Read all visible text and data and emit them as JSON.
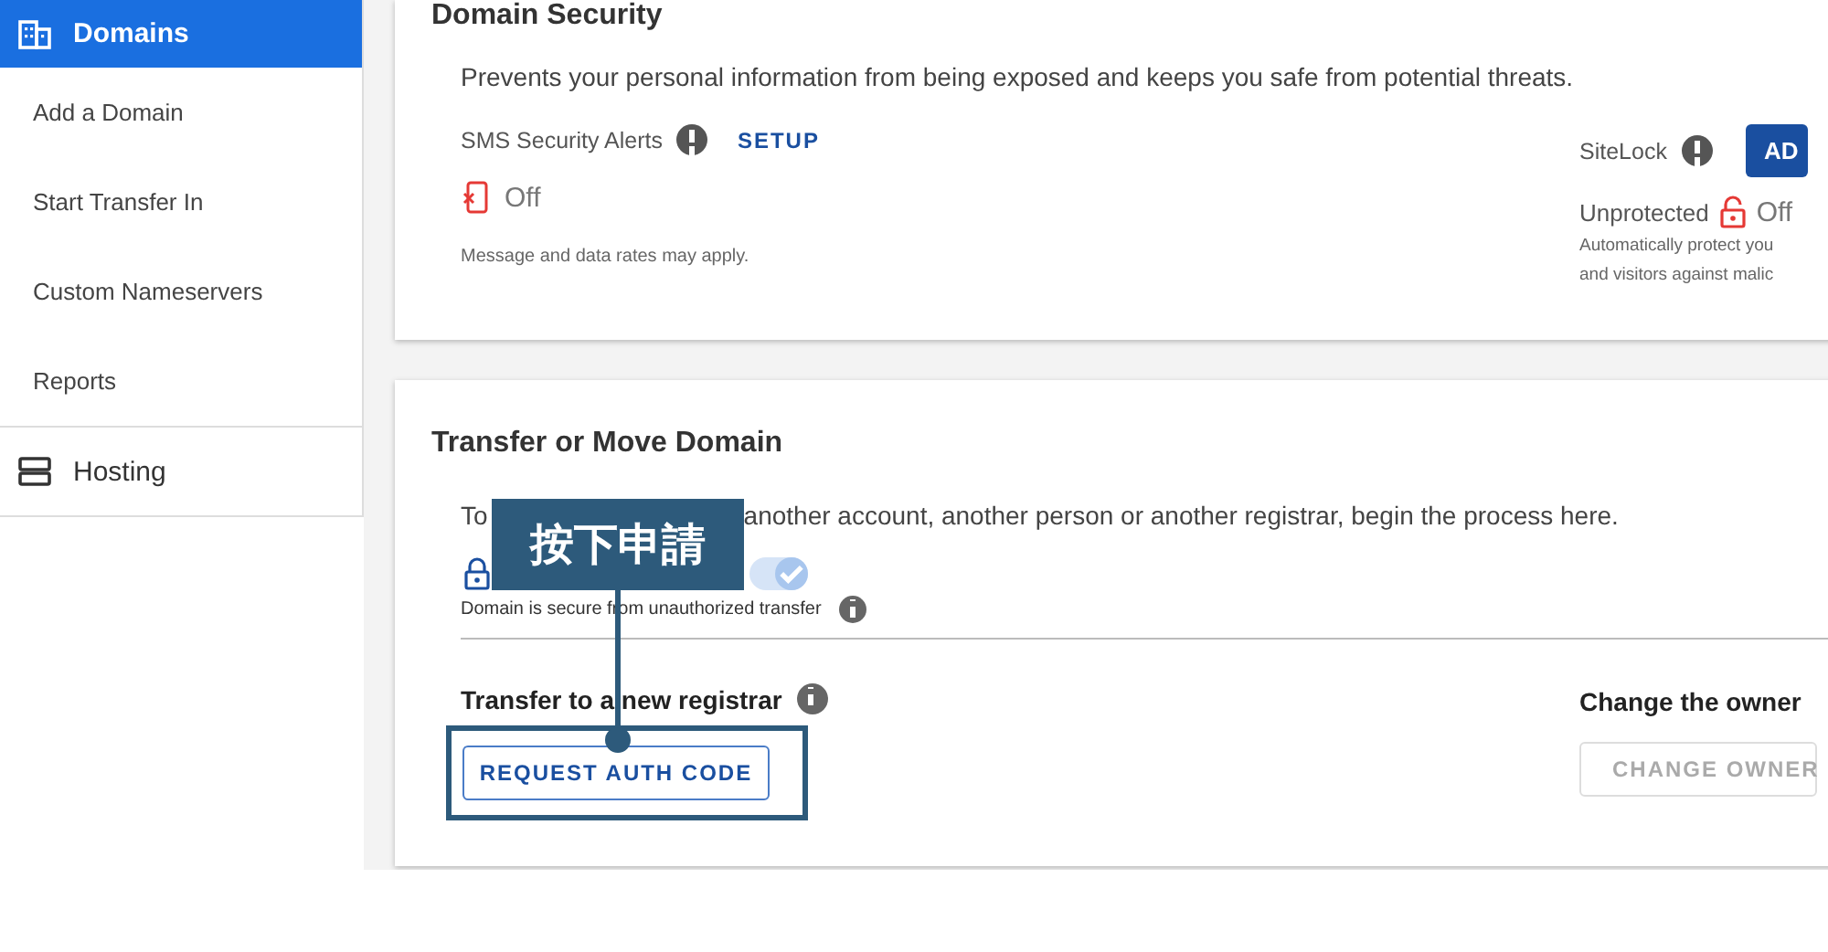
{
  "sidebar": {
    "items": [
      {
        "label": "Domains",
        "kind": "section",
        "selected": true
      },
      {
        "label": "Add a Domain",
        "kind": "link",
        "selected": false
      },
      {
        "label": "Start Transfer In",
        "kind": "link",
        "selected": false
      },
      {
        "label": "Custom Nameservers",
        "kind": "link",
        "selected": false
      },
      {
        "label": "Reports",
        "kind": "link",
        "selected": false
      },
      {
        "label": "Hosting",
        "kind": "section",
        "selected": false
      }
    ]
  },
  "domain_security": {
    "title": "Domain Security",
    "description": "Prevents your personal information from being exposed and keeps you safe from potential threats.",
    "sms": {
      "label": "SMS Security Alerts",
      "action": "SETUP",
      "on": false,
      "status": "Off",
      "note": "Message and data rates may apply."
    },
    "sitelock": {
      "label": "SiteLock",
      "button": "AD",
      "state": "Unprotected",
      "on": false,
      "status": "Off",
      "note_lines": [
        "Automatically protect you",
        "and visitors against malic"
      ]
    }
  },
  "transfer": {
    "title": "Transfer or Move Domain",
    "intro_start": "To",
    "intro_rest": "another account, another person or another registrar, begin the process here.",
    "lock": {
      "on": true,
      "note": "Domain is secure from unauthorized transfer"
    },
    "registrar": {
      "title": "Transfer to a new registrar",
      "button": "REQUEST AUTH CODE"
    },
    "owner": {
      "title": "Change the owner",
      "button": "CHANGE OWNER",
      "disabled": true
    }
  },
  "annotation": {
    "label": "按下申請"
  }
}
